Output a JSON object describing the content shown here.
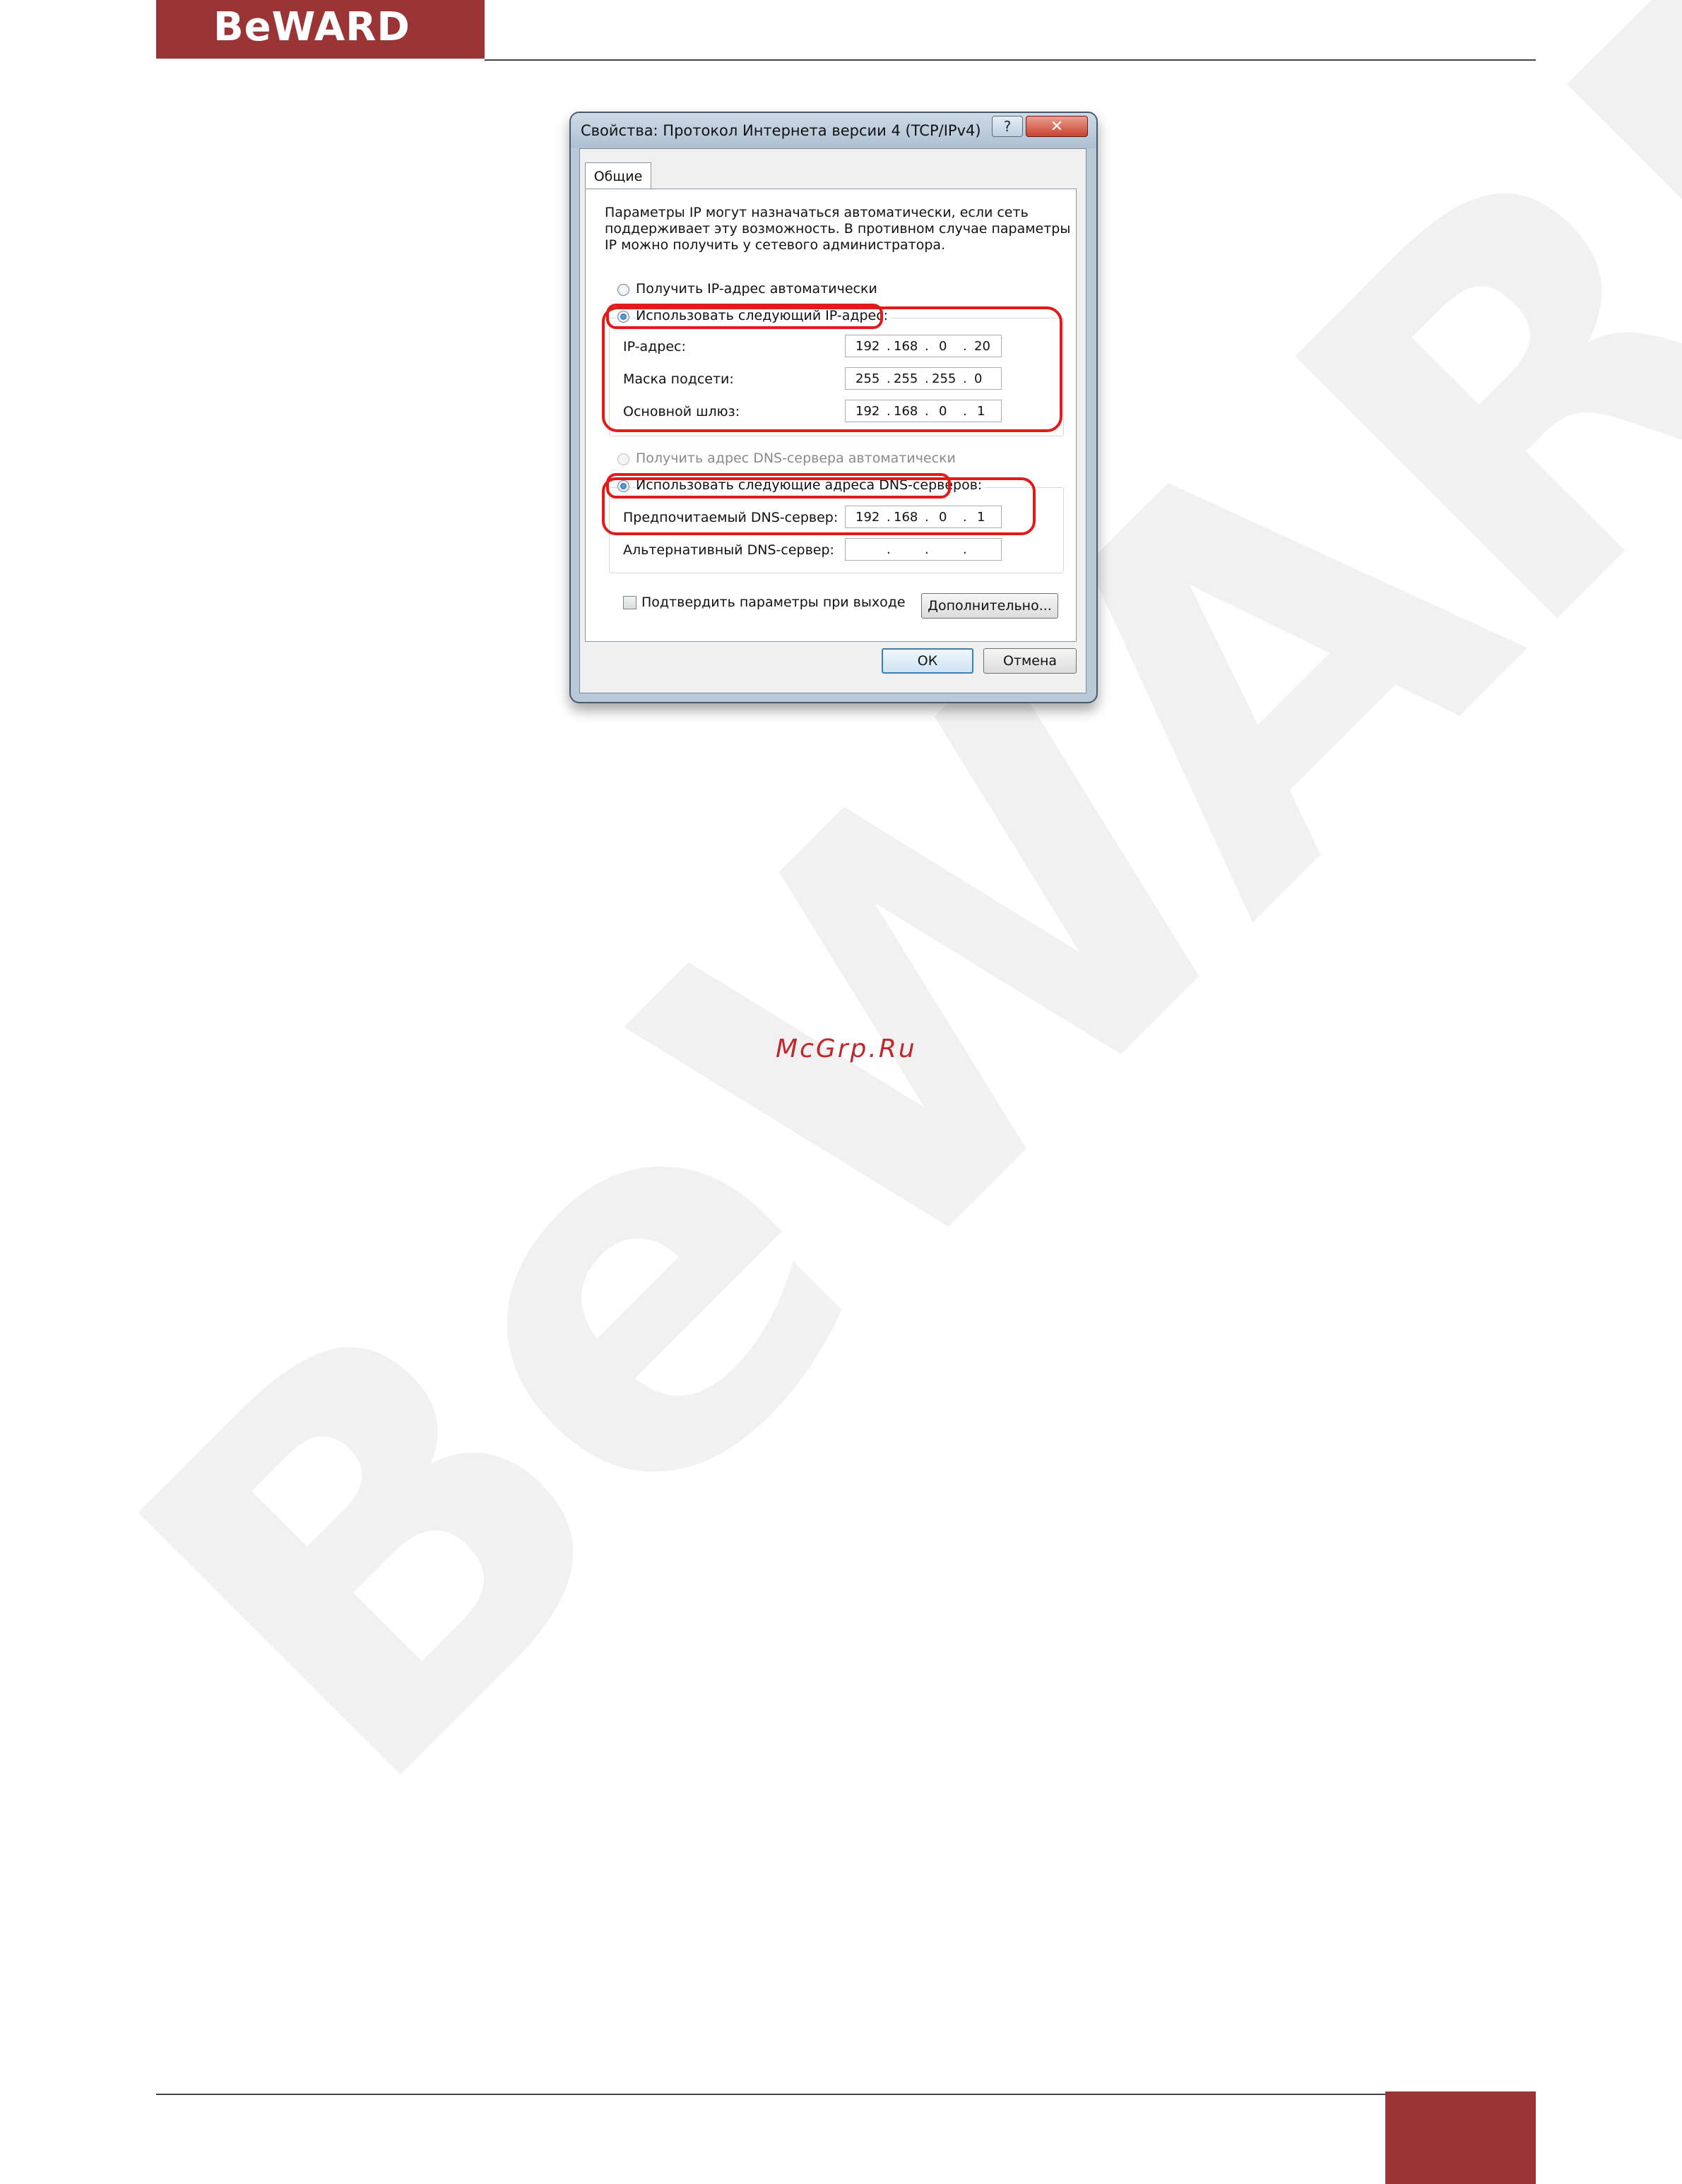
{
  "header": {
    "logo_text": "BeWARD"
  },
  "watermark": {
    "big_text": "BeWARD",
    "site_text": "McGrp.Ru"
  },
  "dialog": {
    "title": "Свойства: Протокол Интернета версии 4 (TCP/IPv4)",
    "help_label": "?",
    "close_label": "✕",
    "tab_label": "Общие",
    "description": [
      "Параметры IP могут назначаться автоматически, если сеть",
      "поддерживает эту возможность. В противном случае параметры",
      "IP можно получить у сетевого администратора."
    ],
    "ip_auto_label": "Получить IP-адрес автоматически",
    "ip_manual_label": "Использовать следующий IP-адрес:",
    "ip_mode": "manual",
    "fields": {
      "ip": {
        "label": "IP-адрес:",
        "octets": [
          "192",
          "168",
          "0",
          "20"
        ]
      },
      "mask": {
        "label": "Маска подсети:",
        "octets": [
          "255",
          "255",
          "255",
          "0"
        ]
      },
      "gateway": {
        "label": "Основной шлюз:",
        "octets": [
          "192",
          "168",
          "0",
          "1"
        ]
      }
    },
    "dns_auto_label": "Получить адрес DNS-сервера автоматически",
    "dns_manual_label": "Использовать следующие адреса DNS-серверов:",
    "dns_mode": "manual",
    "dns": {
      "preferred": {
        "label": "Предпочитаемый DNS-сервер:",
        "octets": [
          "192",
          "168",
          "0",
          "1"
        ]
      },
      "alternate": {
        "label": "Альтернативный DNS-сервер:",
        "octets": [
          "",
          "",
          "",
          ""
        ]
      }
    },
    "confirm_label": "Подтвердить параметры при выходе",
    "confirm_checked": false,
    "advanced_label": "Дополнительно...",
    "ok_label": "ОК",
    "cancel_label": "Отмена"
  },
  "colors": {
    "brand": "#9b3535",
    "annotation": "#e11a1a",
    "watermark": "#f1f1f1"
  }
}
